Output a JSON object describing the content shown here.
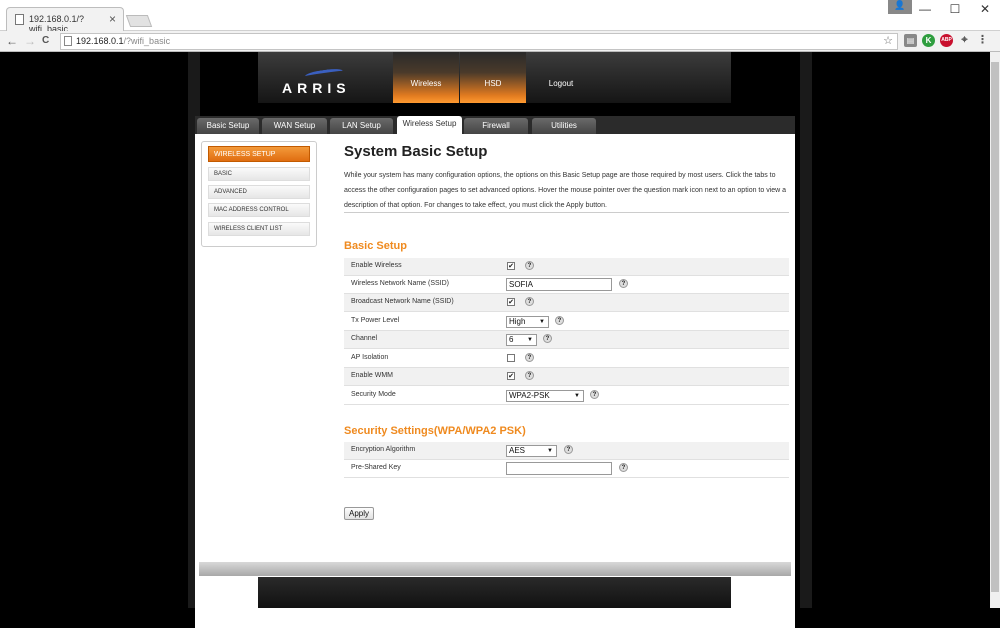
{
  "browser": {
    "tab_title": "192.168.0.1/?wifi_basic",
    "tab_close": "×",
    "url_host": "192.168.0.1",
    "url_path": "/?wifi_basic",
    "nav": {
      "back": "←",
      "forward": "→",
      "reload": "C"
    },
    "window_controls": {
      "minimize": "—",
      "maximize": "☐",
      "close": "✕"
    },
    "user_icon": "👤",
    "extensions": [
      {
        "icon": "layers-icon",
        "glyph": "▤",
        "color": "#888888"
      },
      {
        "icon": "green-k-icon",
        "glyph": "K",
        "color": "#2f9e3f"
      },
      {
        "icon": "adblock-icon",
        "glyph": "ABP",
        "color": "#c8102e"
      },
      {
        "icon": "pin-icon",
        "glyph": "⌖",
        "color": "#555555"
      },
      {
        "icon": "menu-icon",
        "glyph": "⋮",
        "color": "#555555"
      }
    ]
  },
  "header": {
    "logo": "ARRIS",
    "nav": [
      {
        "label": "Wireless",
        "active": true
      },
      {
        "label": "HSD",
        "active": true
      },
      {
        "label": "Logout",
        "active": false
      }
    ]
  },
  "tabs": [
    {
      "label": "Basic Setup",
      "active": false
    },
    {
      "label": "WAN Setup",
      "active": false
    },
    {
      "label": "LAN Setup",
      "active": false
    },
    {
      "label": "Wireless Setup",
      "active": true
    },
    {
      "label": "Firewall",
      "active": false
    },
    {
      "label": "Utilities",
      "active": false
    }
  ],
  "sidebar": {
    "heading": "WIRELESS SETUP",
    "items": [
      {
        "label": "BASIC"
      },
      {
        "label": "ADVANCED"
      },
      {
        "label": "MAC ADDRESS CONTROL"
      },
      {
        "label": "WIRELESS CLIENT LIST"
      }
    ]
  },
  "content": {
    "title": "System Basic Setup",
    "description": "While your system has many configuration options, the options on this Basic Setup page are those required by most users. Click the tabs to access the other configuration pages to set advanced options. Hover the mouse pointer over the question mark icon next to an option to view a description of that option. For changes to take effect, you must click the Apply button.",
    "basic_setup": {
      "title": "Basic Setup",
      "help_glyph": "?",
      "check_glyph": "✔",
      "enable_wireless": {
        "label": "Enable Wireless",
        "checked": true
      },
      "ssid": {
        "label": "Wireless Network Name (SSID)",
        "value": "SOFIA"
      },
      "broadcast": {
        "label": "Broadcast Network Name (SSID)",
        "checked": true
      },
      "tx_power": {
        "label": "Tx Power Level",
        "value": "High"
      },
      "channel": {
        "label": "Channel",
        "value": "6"
      },
      "ap_isolation": {
        "label": "AP Isolation",
        "checked": false
      },
      "wmm": {
        "label": "Enable WMM",
        "checked": true
      },
      "security_mode": {
        "label": "Security Mode",
        "value": "WPA2-PSK"
      }
    },
    "security": {
      "title": "Security Settings(WPA/WPA2 PSK)",
      "encryption": {
        "label": "Encryption Algorithm",
        "value": "AES"
      },
      "psk": {
        "label": "Pre-Shared Key",
        "value": ""
      }
    },
    "apply_label": "Apply"
  }
}
